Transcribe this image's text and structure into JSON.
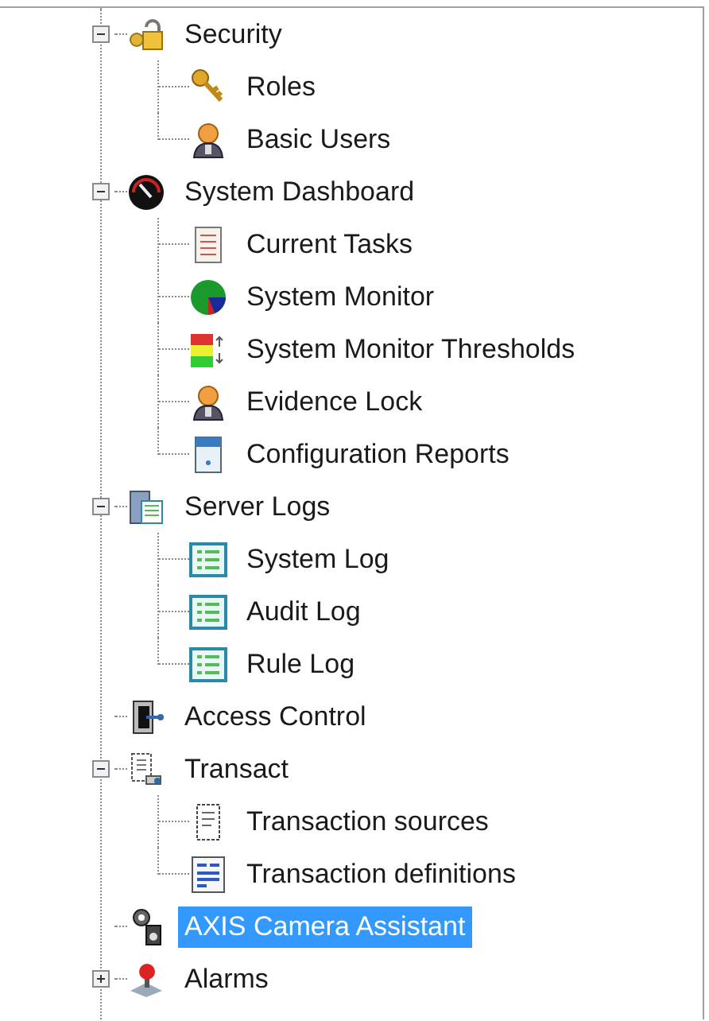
{
  "tree": [
    {
      "label": "Security",
      "kind": "lock",
      "expanded": true,
      "selected": false,
      "children": [
        {
          "label": "Roles",
          "kind": "keys",
          "selected": false
        },
        {
          "label": "Basic Users",
          "kind": "user",
          "selected": false
        }
      ]
    },
    {
      "label": "System Dashboard",
      "kind": "gauge",
      "expanded": true,
      "selected": false,
      "children": [
        {
          "label": "Current Tasks",
          "kind": "list",
          "selected": false
        },
        {
          "label": "System Monitor",
          "kind": "pie",
          "selected": false
        },
        {
          "label": "System Monitor Thresholds",
          "kind": "thresholds",
          "selected": false
        },
        {
          "label": "Evidence Lock",
          "kind": "user",
          "selected": false
        },
        {
          "label": "Configuration Reports",
          "kind": "report",
          "selected": false
        }
      ]
    },
    {
      "label": "Server Logs",
      "kind": "server",
      "expanded": true,
      "selected": false,
      "children": [
        {
          "label": "System Log",
          "kind": "log",
          "selected": false
        },
        {
          "label": "Audit Log",
          "kind": "log",
          "selected": false
        },
        {
          "label": "Rule Log",
          "kind": "log",
          "selected": false
        }
      ]
    },
    {
      "label": "Access Control",
      "kind": "door",
      "selected": false
    },
    {
      "label": "Transact",
      "kind": "transact",
      "expanded": true,
      "selected": false,
      "children": [
        {
          "label": "Transaction sources",
          "kind": "receipt",
          "selected": false
        },
        {
          "label": "Transaction definitions",
          "kind": "definition",
          "selected": false
        }
      ]
    },
    {
      "label": "AXIS Camera Assistant",
      "kind": "camera",
      "selected": true
    },
    {
      "label": "Alarms",
      "kind": "alarm",
      "expanded": false,
      "selected": false
    }
  ]
}
